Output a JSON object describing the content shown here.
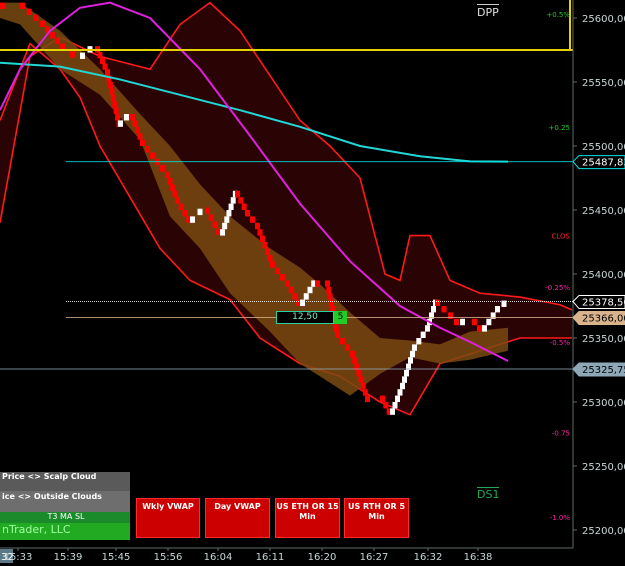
{
  "chart_data": {
    "type": "candlestick-renko",
    "title": "",
    "ylim": [
      25185,
      25615
    ],
    "y_ticks": [
      {
        "value": 25600,
        "label": "25600,00"
      },
      {
        "value": 25550,
        "label": "25550,00"
      },
      {
        "value": 25500,
        "label": "25500,00"
      },
      {
        "value": 25450,
        "label": "25450,00"
      },
      {
        "value": 25400,
        "label": "25400,00"
      },
      {
        "value": 25350,
        "label": "25350,00"
      },
      {
        "value": 25300,
        "label": "25300,00"
      },
      {
        "value": 25250,
        "label": "25250,00"
      },
      {
        "value": 25200,
        "label": "25200,00"
      }
    ],
    "x_ticks": [
      "15:33",
      "15:39",
      "15:45",
      "15:56",
      "16:04",
      "16:11",
      "16:20",
      "16:27",
      "16:32",
      "16:38"
    ],
    "x_tick_first_partial": "32",
    "price_tags": [
      {
        "value": 25487.83,
        "label": "25487,83",
        "color": "#00e5e5"
      },
      {
        "value": 25378.5,
        "label": "25378,50",
        "color": "#ffffff"
      },
      {
        "value": 25366.0,
        "label": "25366,00",
        "color": "#d9b38c"
      },
      {
        "value": 25325.75,
        "label": "25325,75",
        "color": "#8fa8b8"
      }
    ],
    "pct_labels": [
      {
        "value": 25603,
        "label": "+0.5%",
        "color": "#22cc22"
      },
      {
        "value": 25515,
        "label": "+0.25",
        "color": "#22cc22"
      },
      {
        "value": 25430,
        "label": "CLOS",
        "color": "#ff2222"
      },
      {
        "value": 25390,
        "label": "-0.25%",
        "color": "#ff22aa"
      },
      {
        "value": 25347,
        "label": "-0.5%",
        "color": "#ff22aa"
      },
      {
        "value": 25276,
        "label": "-0.75",
        "color": "#ff22aa"
      },
      {
        "value": 25210,
        "label": "-1.0%",
        "color": "#ff22aa"
      }
    ],
    "level_labels": {
      "dpp": "DPP",
      "ds1": "DS1"
    },
    "dpp_level": 25575,
    "ds1_level": 25228,
    "range_box": {
      "label": "12,50",
      "count": "5",
      "value": 25366
    },
    "cyan_line": [
      [
        0,
        25565
      ],
      [
        60,
        25562
      ],
      [
        120,
        25552
      ],
      [
        180,
        25540
      ],
      [
        240,
        25528
      ],
      [
        300,
        25515
      ],
      [
        360,
        25500
      ],
      [
        420,
        25492
      ],
      [
        470,
        25488
      ],
      [
        508,
        25487.83
      ]
    ],
    "magenta_line": [
      [
        0,
        25528
      ],
      [
        20,
        25560
      ],
      [
        50,
        25590
      ],
      [
        80,
        25608
      ],
      [
        110,
        25612
      ],
      [
        150,
        25600
      ],
      [
        200,
        25560
      ],
      [
        250,
        25508
      ],
      [
        300,
        25455
      ],
      [
        350,
        25410
      ],
      [
        400,
        25375
      ],
      [
        440,
        25358
      ],
      [
        470,
        25347
      ],
      [
        508,
        25332
      ]
    ],
    "upper_band": [
      [
        0,
        25440
      ],
      [
        30,
        25570
      ],
      [
        60,
        25585
      ],
      [
        100,
        25570
      ],
      [
        150,
        25560
      ],
      [
        180,
        25595
      ],
      [
        210,
        25612
      ],
      [
        240,
        25590
      ],
      [
        270,
        25555
      ],
      [
        300,
        25520
      ],
      [
        330,
        25500
      ],
      [
        360,
        25475
      ],
      [
        385,
        25400
      ],
      [
        400,
        25395
      ],
      [
        410,
        25430
      ],
      [
        430,
        25430
      ],
      [
        450,
        25395
      ],
      [
        480,
        25385
      ],
      [
        520,
        25382
      ],
      [
        560,
        25376
      ],
      [
        572,
        25372
      ]
    ],
    "lower_band": [
      [
        0,
        25520
      ],
      [
        30,
        25580
      ],
      [
        60,
        25560
      ],
      [
        80,
        25538
      ],
      [
        100,
        25500
      ],
      [
        130,
        25460
      ],
      [
        160,
        25420
      ],
      [
        190,
        25395
      ],
      [
        230,
        25380
      ],
      [
        260,
        25350
      ],
      [
        300,
        25330
      ],
      [
        340,
        25320
      ],
      [
        380,
        25300
      ],
      [
        410,
        25290
      ],
      [
        440,
        25330
      ],
      [
        480,
        25340
      ],
      [
        520,
        25350
      ],
      [
        572,
        25350
      ]
    ],
    "cloud_top": [
      [
        0,
        25612
      ],
      [
        20,
        25612
      ],
      [
        60,
        25590
      ],
      [
        100,
        25560
      ],
      [
        140,
        25525
      ],
      [
        170,
        25500
      ],
      [
        200,
        25470
      ],
      [
        230,
        25445
      ],
      [
        270,
        25420
      ],
      [
        300,
        25405
      ],
      [
        320,
        25392
      ],
      [
        350,
        25370
      ],
      [
        380,
        25350
      ],
      [
        410,
        25348
      ],
      [
        440,
        25345
      ],
      [
        470,
        25355
      ],
      [
        508,
        25358
      ]
    ],
    "cloud_bottom": [
      [
        0,
        25600
      ],
      [
        20,
        25595
      ],
      [
        60,
        25560
      ],
      [
        100,
        25540
      ],
      [
        140,
        25505
      ],
      [
        170,
        25445
      ],
      [
        200,
        25420
      ],
      [
        230,
        25385
      ],
      [
        270,
        25355
      ],
      [
        300,
        25330
      ],
      [
        320,
        25320
      ],
      [
        350,
        25305
      ],
      [
        380,
        25322
      ],
      [
        410,
        25335
      ],
      [
        440,
        25330
      ],
      [
        470,
        25333
      ],
      [
        508,
        25340
      ]
    ],
    "price_path": [
      [
        0,
        25612
      ],
      [
        20,
        25612
      ],
      [
        40,
        25598
      ],
      [
        60,
        25580
      ],
      [
        80,
        25568
      ],
      [
        95,
        25578
      ],
      [
        105,
        25560
      ],
      [
        118,
        25515
      ],
      [
        130,
        25525
      ],
      [
        140,
        25505
      ],
      [
        150,
        25495
      ],
      [
        165,
        25480
      ],
      [
        175,
        25460
      ],
      [
        190,
        25440
      ],
      [
        205,
        25452
      ],
      [
        220,
        25430
      ],
      [
        235,
        25465
      ],
      [
        245,
        25450
      ],
      [
        255,
        25440
      ],
      [
        270,
        25410
      ],
      [
        285,
        25395
      ],
      [
        300,
        25375
      ],
      [
        315,
        25395
      ],
      [
        325,
        25395
      ],
      [
        335,
        25355
      ],
      [
        350,
        25340
      ],
      [
        365,
        25305
      ],
      [
        380,
        25305
      ],
      [
        390,
        25290
      ],
      [
        400,
        25310
      ],
      [
        412,
        25340
      ],
      [
        425,
        25355
      ],
      [
        435,
        25380
      ],
      [
        448,
        25370
      ],
      [
        460,
        25360
      ],
      [
        472,
        25365
      ],
      [
        482,
        25355
      ],
      [
        495,
        25370
      ],
      [
        508,
        25378.5
      ]
    ],
    "renko_brick": 5
  },
  "buttons": [
    {
      "line1": "Wkly VWAP",
      "line2": ""
    },
    {
      "line1": "Day VWAP",
      "line2": ""
    },
    {
      "line1": "US ETH OR 15",
      "line2": "Min"
    },
    {
      "line1": "US RTH OR 5",
      "line2": "Min"
    }
  ],
  "panel": {
    "row1": "Price <> Scalp Cloud",
    "row2": "ice <> Outside Clouds",
    "row3": "T3 MA SL",
    "row4": "nTrader, LLC"
  },
  "colors": {
    "bg": "#000000",
    "bull": "#ffffff",
    "bear": "#ff0000",
    "band": "#ff1a1a",
    "cloud": "#7a4a10",
    "cyan": "#22d6d6",
    "magenta": "#e020e0",
    "dpp": "#e6d200"
  }
}
